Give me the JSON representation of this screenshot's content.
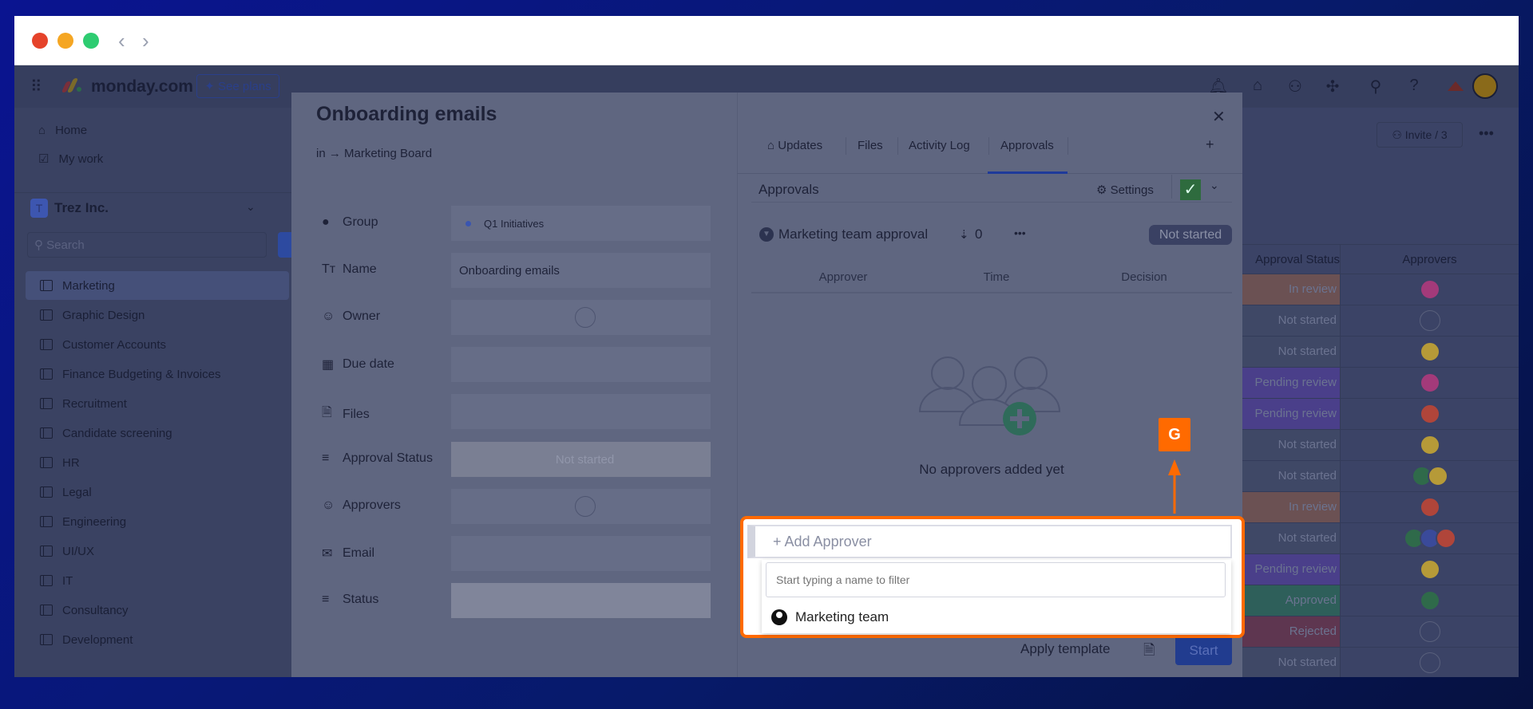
{
  "browser": {
    "back": "‹",
    "forward": "›"
  },
  "header": {
    "brand": "monday.com",
    "see_plans": "See plans",
    "help": "?"
  },
  "sidebar": {
    "home": "Home",
    "my_work": "My work",
    "workspace_initial": "T",
    "workspace": "Trez Inc.",
    "search_placeholder": "Search",
    "boards": [
      "Marketing",
      "Graphic Design",
      "Customer Accounts",
      "Finance Budgeting & Invoices",
      "Recruitment",
      "Candidate screening",
      "HR",
      "Legal",
      "Engineering",
      "UI/UX",
      "IT",
      "Consultancy",
      "Development"
    ]
  },
  "board": {
    "invite": "Invite / 3",
    "col_status": "Approval Status",
    "col_approvers": "Approvers",
    "rows": [
      {
        "status": "In review",
        "color": "#6b5153",
        "avatars": [
          "#a33a7a"
        ]
      },
      {
        "status": "Not started",
        "color": "#3f4866",
        "avatars": []
      },
      {
        "status": "Not started",
        "color": "#3f4866",
        "avatars": [
          "#b69a38"
        ]
      },
      {
        "status": "Pending review",
        "color": "#4a3f8a",
        "avatars": [
          "#a33a7a"
        ]
      },
      {
        "status": "Pending review",
        "color": "#4a3f8a",
        "avatars": [
          "#b0453a"
        ]
      },
      {
        "status": "Not started",
        "color": "#3f4866",
        "avatars": [
          "#b69a38"
        ]
      },
      {
        "status": "Not started",
        "color": "#3f4866",
        "avatars": [
          "#2f6a4a",
          "#b69a38"
        ]
      },
      {
        "status": "In review",
        "color": "#6b5153",
        "avatars": [
          "#b0453a"
        ]
      },
      {
        "status": "Not started",
        "color": "#3f4866",
        "avatars": [
          "#2f6a4a",
          "#3a4a9a",
          "#b0453a"
        ]
      },
      {
        "status": "Pending review",
        "color": "#4a3f8a",
        "avatars": [
          "#b69a38"
        ]
      },
      {
        "status": "Approved",
        "color": "#2e5f5a",
        "avatars": [
          "#2f6a4a"
        ]
      },
      {
        "status": "Rejected",
        "color": "#5e3650",
        "avatars": []
      },
      {
        "status": "Not started",
        "color": "#3f4866",
        "avatars": []
      }
    ]
  },
  "item": {
    "title": "Onboarding emails",
    "breadcrumb": "in → Marketing Board",
    "fields": [
      {
        "label": "Group",
        "value": "Q1 Initiatives"
      },
      {
        "label": "Name",
        "value": "Onboarding emails"
      },
      {
        "label": "Owner",
        "value": ""
      },
      {
        "label": "Due date",
        "value": ""
      },
      {
        "label": "Files",
        "value": ""
      },
      {
        "label": "Approval Status",
        "value": "Not started"
      },
      {
        "label": "Approvers",
        "value": ""
      },
      {
        "label": "Email",
        "value": ""
      },
      {
        "label": "Status",
        "value": ""
      }
    ]
  },
  "panel": {
    "tabs": [
      "Updates",
      "Files",
      "Activity Log",
      "Approvals"
    ],
    "active_tab": "Approvals",
    "add_tab": "+",
    "close": "✕",
    "heading": "Approvals",
    "settings": "Settings",
    "flow": {
      "name": "Marketing team approval",
      "count": "0",
      "status": "Not started"
    },
    "columns": [
      "Approver",
      "Time",
      "Decision"
    ],
    "empty_text": "No approvers added yet",
    "add_approver": "+ Add Approver",
    "filter_placeholder": "Start typing a name to filter",
    "options": [
      "Marketing team"
    ],
    "apply_template": "Apply template",
    "start": "Start"
  },
  "annotation": {
    "label": "G",
    "color": "#ff6a00"
  }
}
